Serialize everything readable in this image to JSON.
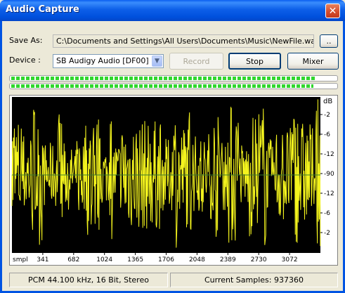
{
  "window": {
    "title": "Audio Capture",
    "close_glyph": "✕"
  },
  "save_as": {
    "label": "Save As:",
    "path": "C:\\Documents and Settings\\All Users\\Documents\\Music\\NewFile.wav",
    "browse_label": ".."
  },
  "device": {
    "label": "Device :",
    "selected": "SB Audigy Audio [DF00]",
    "record_label": "Record",
    "stop_label": "Stop",
    "mixer_label": "Mixer"
  },
  "levels": {
    "left": 0.94,
    "right": 0.93
  },
  "scope": {
    "db_label": "dB",
    "db_ticks": [
      "-2",
      "-6",
      "-12",
      "-90",
      "-12",
      "-6",
      "-2"
    ],
    "x_label": "smpl",
    "x_ticks": [
      "341",
      "682",
      "1024",
      "1365",
      "1706",
      "2048",
      "2389",
      "2730",
      "3072"
    ],
    "colors": {
      "background": "#000000",
      "wave": "#f4f41e",
      "grid": "#3a7a2a"
    }
  },
  "status": {
    "format": "PCM 44.100 kHz, 16 Bit, Stereo",
    "samples": "Current Samples: 937360"
  }
}
